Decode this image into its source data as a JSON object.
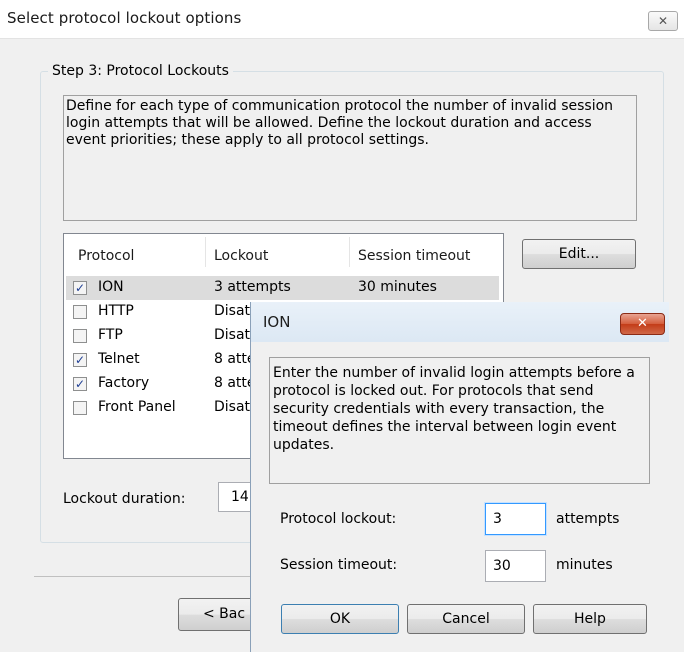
{
  "main": {
    "title": "Select protocol lockout options",
    "close_glyph": "✕",
    "group_label": "Step 3: Protocol Lockouts",
    "description": "Define for each type of communication protocol the number of invalid session login attempts that will be allowed. Define the lockout duration and access event priorities; these apply to all protocol settings.",
    "columns": [
      "Protocol",
      "Lockout",
      "Session timeout"
    ],
    "rows": [
      {
        "checked": true,
        "protocol": "ION",
        "lockout": "3 attempts",
        "timeout": "30 minutes"
      },
      {
        "checked": false,
        "protocol": "HTTP",
        "lockout": "Disat",
        "timeout": ""
      },
      {
        "checked": false,
        "protocol": "FTP",
        "lockout": "Disat",
        "timeout": ""
      },
      {
        "checked": true,
        "protocol": "Telnet",
        "lockout": "8 atte",
        "timeout": ""
      },
      {
        "checked": true,
        "protocol": "Factory",
        "lockout": "8 atte",
        "timeout": ""
      },
      {
        "checked": false,
        "protocol": "Front Panel",
        "lockout": "Disat",
        "timeout": ""
      }
    ],
    "edit_label": "Edit...",
    "lockout_duration_label": "Lockout duration:",
    "lockout_duration_value": "14",
    "back_label": "< Bac"
  },
  "ion": {
    "title": "ION",
    "close_glyph": "✕",
    "description": "Enter the number of invalid login attempts before a protocol is locked out.  For protocols that send security credentials with every transaction, the timeout defines the interval between login event updates.",
    "protocol_lockout_label": "Protocol lockout:",
    "protocol_lockout_value": "3",
    "protocol_lockout_unit": "attempts",
    "session_timeout_label": "Session timeout:",
    "session_timeout_value": "30",
    "session_timeout_unit": "minutes",
    "ok_label": "OK",
    "cancel_label": "Cancel",
    "help_label": "Help"
  }
}
